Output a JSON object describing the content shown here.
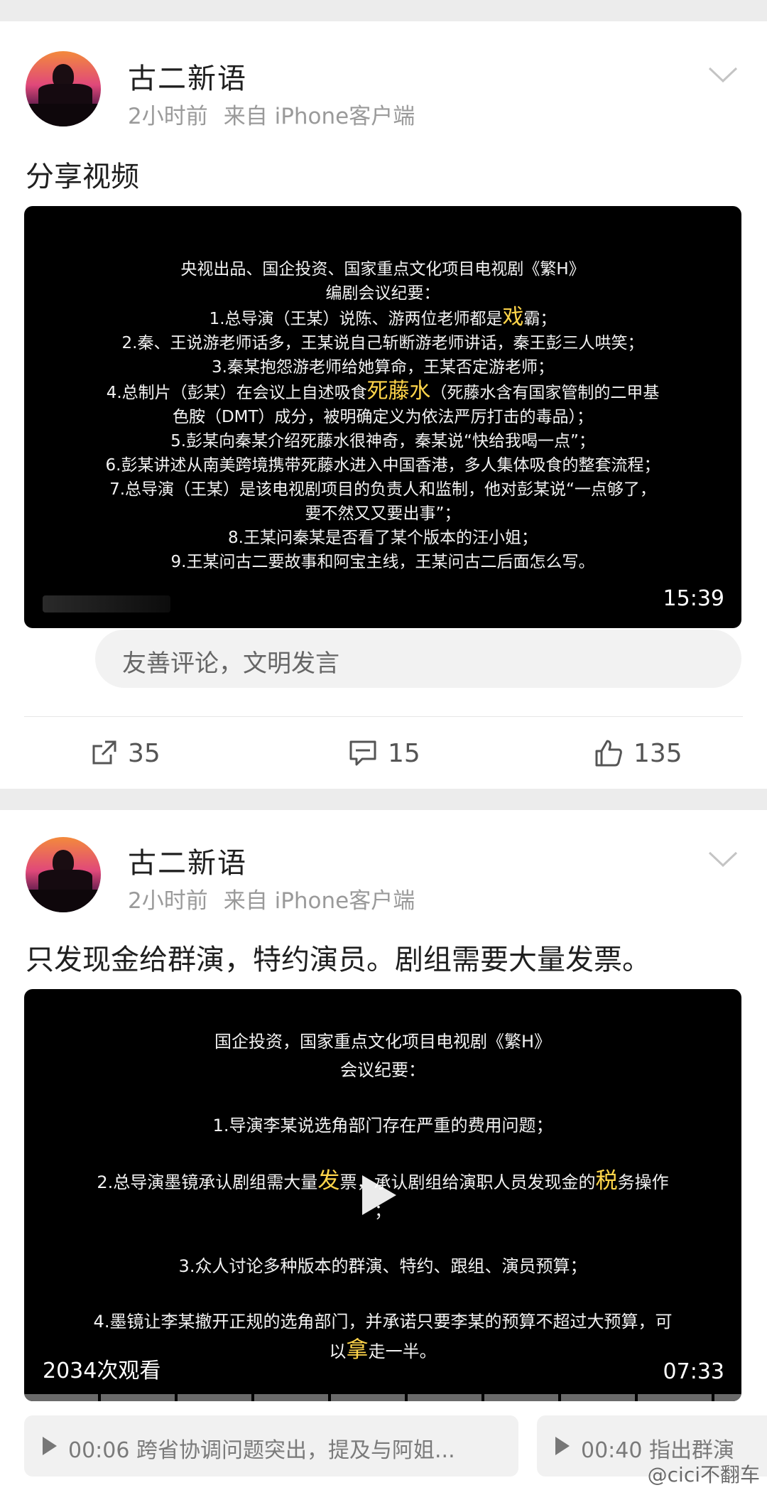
{
  "posts": [
    {
      "author": "古二新语",
      "time": "2小时前",
      "source": "来自 iPhone客户端",
      "text": "分享视频",
      "video": {
        "lines": [
          "央视出品、国企投资、国家重点文化项目电视剧《繁H》",
          "编剧会议纪要：",
          "1.总导演（王某）说陈、游两位老师都是",
          "戏",
          "霸；",
          "2.秦、王说游老师话多，王某说自己斩断游老师讲话，秦王彭三人哄笑；",
          "3.秦某抱怨游老师给她算命，王某否定游老师；",
          "4.总制片（彭某）在会议上自述吸食",
          "死藤水",
          "（死藤水含有国家管制的二甲基",
          "色胺（DMT）成分，被明确定义为依法严厉打击的毒品）；",
          "5.彭某向秦某介绍死藤水很神奇，秦某说“快给我喝一点”；",
          "6.彭某讲述从南美跨境携带死藤水进入中国香港，多人集体吸食的整套流程；",
          "7.总导演（王某）是该电视剧项目的负责人和监制，他对彭某说“一点够了，",
          "要不然又又要出事”；",
          "8.王某问秦某是否看了某个版本的汪小姐；",
          "9.王某问古二要故事和阿宝主线，王某问古二后面怎么写。"
        ],
        "duration": "15:39"
      },
      "comment_placeholder": "友善评论，文明发言",
      "actions": {
        "shares": "35",
        "comments": "15",
        "likes": "135"
      }
    },
    {
      "author": "古二新语",
      "time": "2小时前",
      "source": "来自 iPhone客户端",
      "text": "只发现金给群演，特约演员。剧组需要大量发票。",
      "video": {
        "lines": [
          "国企投资，国家重点文化项目电视剧《繁H》",
          "会议纪要：",
          "1.导演李某说选角部门存在严重的费用问题；",
          "2.总导演墨镜承认剧组需大量",
          "发",
          "票，承认剧组给演职人员发现金的",
          "税",
          "务操作",
          "；",
          "3.众人讨论多种版本的群演、特约、跟组、演员预算；",
          "4.墨镜让李某撤开正规的选角部门，并承诺只要李某的预算不超过大预算，可",
          "以",
          "拿",
          "走一半。"
        ],
        "views": "2034次观看",
        "duration": "07:33"
      },
      "clips": [
        {
          "time": "00:06",
          "text": "跨省协调问题突出，提及与阿姐..."
        },
        {
          "time": "00:40",
          "text": "指出群演"
        }
      ]
    }
  ],
  "watermark": "@cici不翻车",
  "colors": {
    "highlight": "#ffd54a",
    "video_bg": "#000000",
    "separator": "#ececec"
  }
}
